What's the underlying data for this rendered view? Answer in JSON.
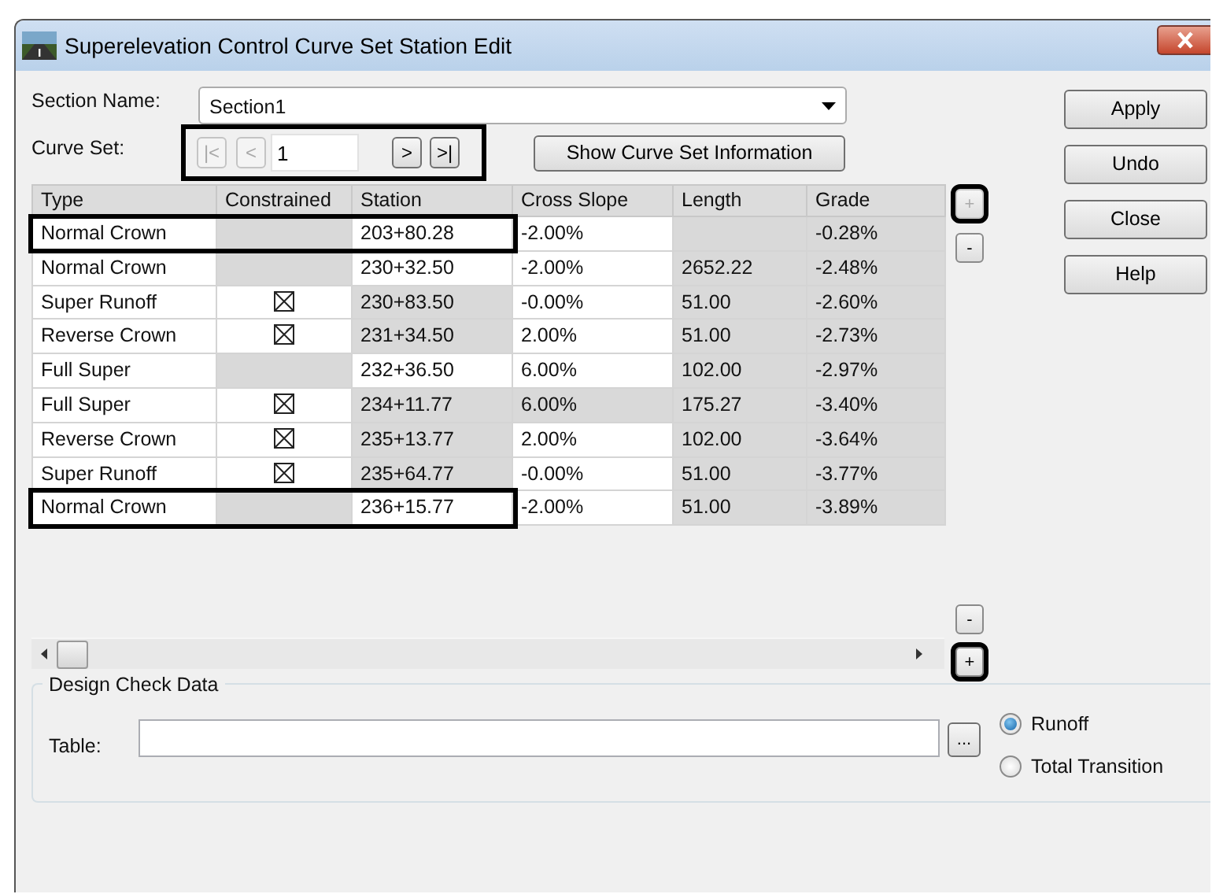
{
  "window": {
    "title": "Superelevation Control Curve Set Station Edit"
  },
  "section_name": {
    "label": "Section Name:",
    "value": "Section1"
  },
  "curve_set": {
    "label": "Curve Set:",
    "value": "1",
    "highlighted": true,
    "nav_buttons": [
      {
        "glyph": "|<",
        "disabled": true
      },
      {
        "glyph": "<",
        "disabled": true
      },
      {
        "glyph": ">",
        "disabled": false
      },
      {
        "glyph": ">|",
        "disabled": false
      }
    ]
  },
  "show_info_button": "Show Curve Set Information",
  "table": {
    "columns": [
      "Type",
      "Constrained",
      "Station",
      "Cross Slope",
      "Length",
      "Grade"
    ],
    "rows": [
      {
        "highlighted": true,
        "cells": [
          {
            "text": "Normal Crown",
            "read_only": false
          },
          {
            "checked": false,
            "read_only": true
          },
          {
            "text": "203+80.28",
            "read_only": false
          },
          {
            "text": "-2.00%",
            "read_only": false
          },
          {
            "read_only": true
          },
          {
            "text": "-0.28%",
            "read_only": true
          }
        ]
      },
      {
        "highlighted": false,
        "cells": [
          {
            "text": "Normal Crown",
            "read_only": false
          },
          {
            "checked": false,
            "read_only": true
          },
          {
            "text": "230+32.50",
            "read_only": false
          },
          {
            "text": "-2.00%",
            "read_only": false
          },
          {
            "text": "2652.22",
            "read_only": true
          },
          {
            "text": "-2.48%",
            "read_only": true
          }
        ]
      },
      {
        "highlighted": false,
        "cells": [
          {
            "text": "Super Runoff",
            "read_only": false
          },
          {
            "checked": true,
            "read_only": false
          },
          {
            "text": "230+83.50",
            "read_only": true
          },
          {
            "text": "-0.00%",
            "read_only": false
          },
          {
            "text": "51.00",
            "read_only": true
          },
          {
            "text": "-2.60%",
            "read_only": true
          }
        ]
      },
      {
        "highlighted": false,
        "cells": [
          {
            "text": "Reverse Crown",
            "read_only": false
          },
          {
            "checked": true,
            "read_only": false
          },
          {
            "text": "231+34.50",
            "read_only": true
          },
          {
            "text": "2.00%",
            "read_only": false
          },
          {
            "text": "51.00",
            "read_only": true
          },
          {
            "text": "-2.73%",
            "read_only": true
          }
        ]
      },
      {
        "highlighted": false,
        "cells": [
          {
            "text": "Full Super",
            "read_only": false
          },
          {
            "checked": false,
            "read_only": true
          },
          {
            "text": "232+36.50",
            "read_only": false
          },
          {
            "text": "6.00%",
            "read_only": false
          },
          {
            "text": "102.00",
            "read_only": true
          },
          {
            "text": "-2.97%",
            "read_only": true
          }
        ]
      },
      {
        "highlighted": false,
        "cells": [
          {
            "text": "Full Super",
            "read_only": false
          },
          {
            "checked": true,
            "read_only": false
          },
          {
            "text": "234+11.77",
            "read_only": true
          },
          {
            "text": "6.00%",
            "read_only": true
          },
          {
            "text": "175.27",
            "read_only": true
          },
          {
            "text": "-3.40%",
            "read_only": true
          }
        ]
      },
      {
        "highlighted": false,
        "cells": [
          {
            "text": "Reverse Crown",
            "read_only": false
          },
          {
            "checked": true,
            "read_only": false
          },
          {
            "text": "235+13.77",
            "read_only": true
          },
          {
            "text": "2.00%",
            "read_only": false
          },
          {
            "text": "102.00",
            "read_only": true
          },
          {
            "text": "-3.64%",
            "read_only": true
          }
        ]
      },
      {
        "highlighted": false,
        "cells": [
          {
            "text": "Super Runoff",
            "read_only": false
          },
          {
            "checked": true,
            "read_only": false
          },
          {
            "text": "235+64.77",
            "read_only": true
          },
          {
            "text": "-0.00%",
            "read_only": false
          },
          {
            "text": "51.00",
            "read_only": true
          },
          {
            "text": "-3.77%",
            "read_only": true
          }
        ]
      },
      {
        "highlighted": true,
        "cells": [
          {
            "text": "Normal Crown",
            "read_only": false
          },
          {
            "checked": false,
            "read_only": true
          },
          {
            "text": "236+15.77",
            "read_only": false
          },
          {
            "text": "-2.00%",
            "read_only": false
          },
          {
            "text": "51.00",
            "read_only": true
          },
          {
            "text": "-3.89%",
            "read_only": true
          }
        ]
      }
    ]
  },
  "row_buttons_top": [
    {
      "glyph": "+",
      "disabled": true,
      "highlighted": true
    },
    {
      "glyph": "-",
      "disabled": false,
      "highlighted": false
    }
  ],
  "row_buttons_bottom": [
    {
      "glyph": "-",
      "disabled": false,
      "highlighted": false
    },
    {
      "glyph": "+",
      "disabled": false,
      "highlighted": true
    }
  ],
  "action_buttons": [
    "Apply",
    "Undo",
    "Close",
    "Help"
  ],
  "design_check": {
    "title": "Design Check Data",
    "table_label": "Table:",
    "browse_button": "...",
    "options": [
      {
        "label": "Runoff",
        "selected": true
      },
      {
        "label": "Total Transition",
        "selected": false
      }
    ]
  }
}
